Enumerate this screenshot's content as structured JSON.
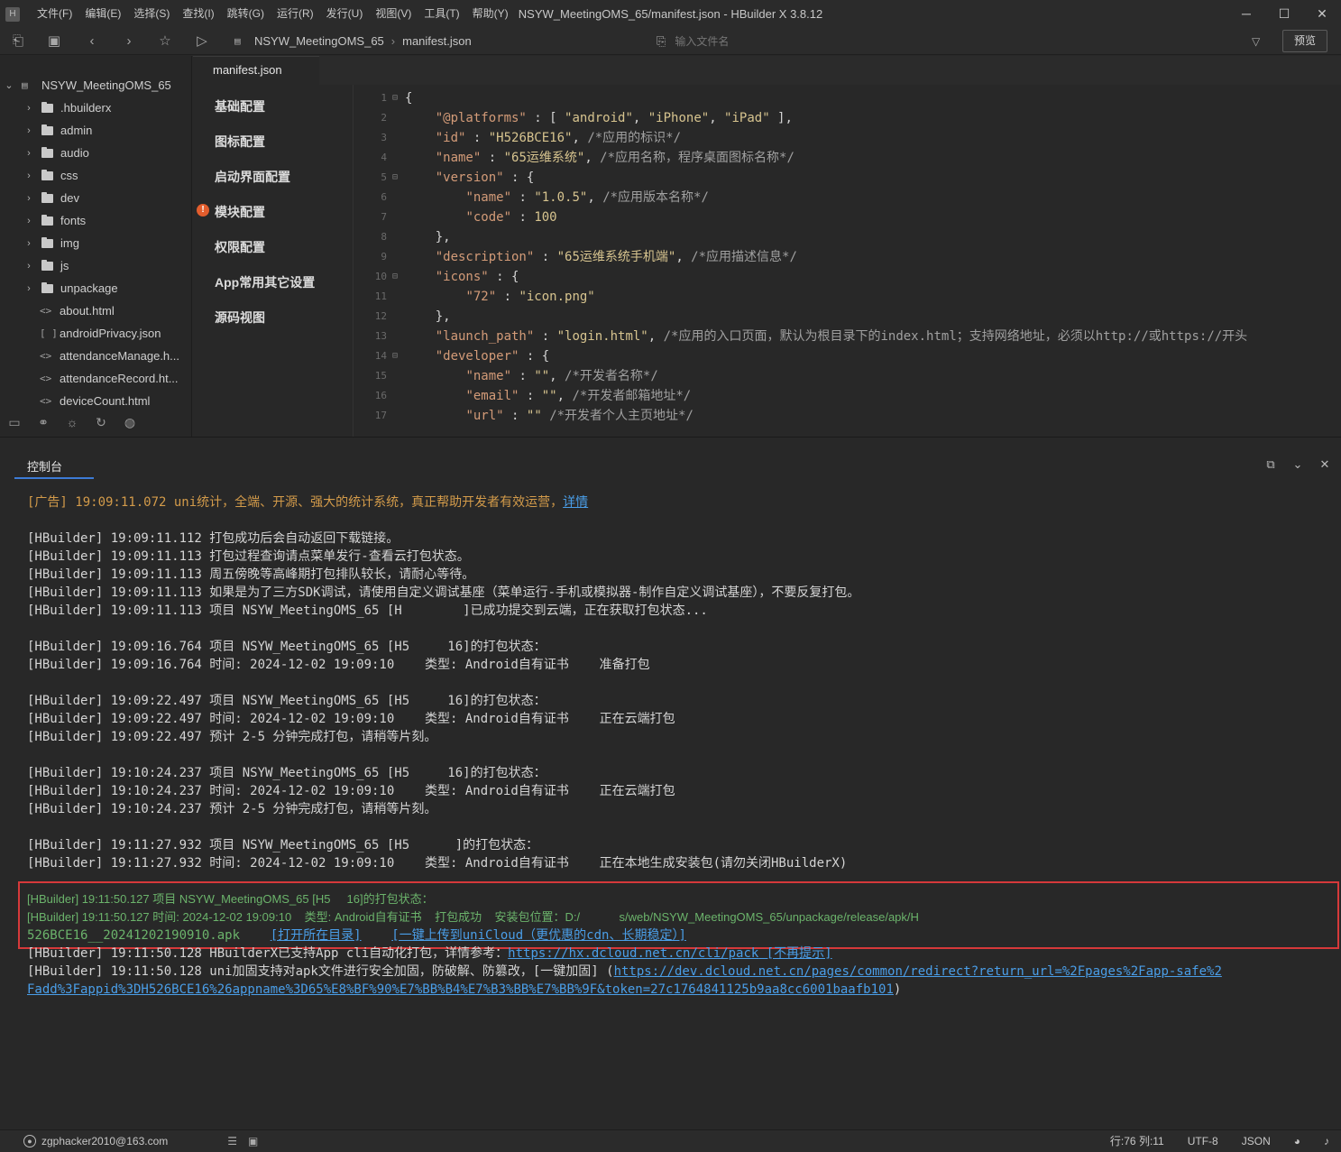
{
  "titlebar": {
    "title": "NSYW_MeetingOMS_65/manifest.json - HBuilder X 3.8.12",
    "menus": [
      "文件(F)",
      "编辑(E)",
      "选择(S)",
      "查找(I)",
      "跳转(G)",
      "运行(R)",
      "发行(U)",
      "视图(V)",
      "工具(T)",
      "帮助(Y)"
    ],
    "controls": [
      "─",
      "☐",
      "✕"
    ]
  },
  "toolbar": {
    "breadcrumb": [
      "NSYW_MeetingOMS_65",
      "manifest.json"
    ],
    "file_search_placeholder": "输入文件名",
    "preview_label": "预览"
  },
  "sidebar": {
    "project": "NSYW_MeetingOMS_65",
    "items": [
      {
        "label": ".hbuilderx",
        "kind": "folder"
      },
      {
        "label": "admin",
        "kind": "folder"
      },
      {
        "label": "audio",
        "kind": "folder"
      },
      {
        "label": "css",
        "kind": "folder"
      },
      {
        "label": "dev",
        "kind": "folder"
      },
      {
        "label": "fonts",
        "kind": "folder"
      },
      {
        "label": "img",
        "kind": "folder"
      },
      {
        "label": "js",
        "kind": "folder"
      },
      {
        "label": "unpackage",
        "kind": "folder"
      },
      {
        "label": "about.html",
        "kind": "html"
      },
      {
        "label": "androidPrivacy.json",
        "kind": "json"
      },
      {
        "label": "attendanceManage.h...",
        "kind": "html"
      },
      {
        "label": "attendanceRecord.ht...",
        "kind": "html"
      },
      {
        "label": "deviceCount.html",
        "kind": "html"
      }
    ]
  },
  "editor": {
    "tab": "manifest.json",
    "config_nav": [
      "基础配置",
      "图标配置",
      "启动界面配置",
      "模块配置",
      "权限配置",
      "App常用其它设置",
      "源码视图"
    ]
  },
  "code_lines": [
    "{",
    "    \"@platforms\" : [ \"android\", \"iPhone\", \"iPad\" ],",
    "    \"id\" : \"H526BCE16\", /*应用的标识*/",
    "    \"name\" : \"65运维系统\", /*应用名称，程序桌面图标名称*/",
    "    \"version\" : {",
    "        \"name\" : \"1.0.5\", /*应用版本名称*/",
    "        \"code\" : 100",
    "    },",
    "    \"description\" : \"65运维系统手机端\", /*应用描述信息*/",
    "    \"icons\" : {",
    "        \"72\" : \"icon.png\"",
    "    },",
    "    \"launch_path\" : \"login.html\", /*应用的入口页面，默认为根目录下的index.html；支持网络地址，必须以http://或https://开头",
    "    \"developer\" : {",
    "        \"name\" : \"\", /*开发者名称*/",
    "        \"email\" : \"\", /*开发者邮箱地址*/",
    "        \"url\" : \"\" /*开发者个人主页地址*/"
  ],
  "console": {
    "tab": "控制台",
    "ad": {
      "text": "[广告] 19:09:11.072 uni统计，全端、开源、强大的统计系统，真正帮助开发者有效运营，",
      "link": "详情"
    },
    "lines": [
      "[HBuilder] 19:09:11.112 打包成功后会自动返回下载链接。",
      "[HBuilder] 19:09:11.113 打包过程查询请点菜单发行-查看云打包状态。",
      "[HBuilder] 19:09:11.113 周五傍晚等高峰期打包排队较长，请耐心等待。",
      "[HBuilder] 19:09:11.113 如果是为了三方SDK调试，请使用自定义调试基座（菜单运行-手机或模拟器-制作自定义调试基座），不要反复打包。",
      "[HBuilder] 19:09:11.113 项目 NSYW_MeetingOMS_65 [H        ]已成功提交到云端，正在获取打包状态...",
      "[HBuilder] 19:09:16.764 项目 NSYW_MeetingOMS_65 [H5     16]的打包状态：",
      "[HBuilder] 19:09:16.764 时间: 2024-12-02 19:09:10    类型: Android自有证书    准备打包",
      "[HBuilder] 19:09:22.497 项目 NSYW_MeetingOMS_65 [H5     16]的打包状态：",
      "[HBuilder] 19:09:22.497 时间: 2024-12-02 19:09:10    类型: Android自有证书    正在云端打包",
      "[HBuilder] 19:09:22.497 预计 2-5 分钟完成打包，请稍等片刻。",
      "[HBuilder] 19:10:24.237 项目 NSYW_MeetingOMS_65 [H5     16]的打包状态：",
      "[HBuilder] 19:10:24.237 时间: 2024-12-02 19:09:10    类型: Android自有证书    正在云端打包",
      "[HBuilder] 19:10:24.237 预计 2-5 分钟完成打包，请稍等片刻。",
      "[HBuilder] 19:11:27.932 项目 NSYW_MeetingOMS_65 [H5      ]的打包状态：",
      "[HBuilder] 19:11:27.932 时间: 2024-12-02 19:09:10    类型: Android自有证书    正在本地生成安装包(请勿关闭HBuilderX)"
    ],
    "success": {
      "line1": "[HBuilder] 19:11:50.127 项目 NSYW_MeetingOMS_65 [H5     16]的打包状态：",
      "line2": "[HBuilder] 19:11:50.127 时间: 2024-12-02 19:09:10    类型: Android自有证书    打包成功    安装包位置：D:/            s/web/NSYW_MeetingOMS_65/unpackage/release/apk/H",
      "line3_text": "526BCE16__20241202190910.apk    ",
      "open_dir": "[打开所在目录]",
      "upload": "[一键上传到uniCloud（更优惠的cdn、长期稳定）]"
    },
    "cli_line": {
      "text": "[HBuilder] 19:11:50.128 HBuilderX已支持App cli自动化打包，详情参考：",
      "link": "https://hx.dcloud.net.cn/cli/pack",
      "suffix": " [不再提示]"
    },
    "safe_line": {
      "text": "[HBuilder] 19:11:50.128 uni加固支持对apk文件进行安全加固，防破解、防篡改，[一键加固] (",
      "link1": "https://dev.dcloud.net.cn/pages/common/redirect?return_url=%2Fpages%2Fapp-safe%2",
      "link2": "Fadd%3Fappid%3DH526BCE16%26appname%3D65%E8%BF%90%E7%BB%B4%E7%B3%BB%E7%BB%9F&token=27c1764841125b9aa8cc6001baafb101",
      "suffix": ")"
    }
  },
  "statusbar": {
    "user": "zgphacker2010@163.com",
    "position": "行:76  列:11",
    "encoding": "UTF-8",
    "language": "JSON"
  },
  "colors": {
    "accent": "#3d7bd6",
    "highlight_border": "#d6393a",
    "success_text": "#6bb36b",
    "link": "#4a9ee8"
  }
}
